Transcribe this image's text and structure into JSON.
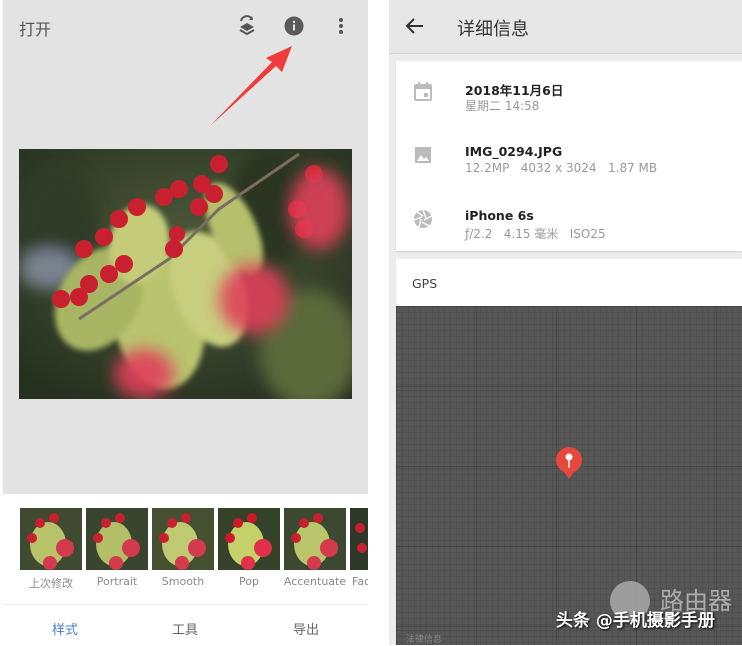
{
  "left_panel": {
    "title": "打开",
    "toolbar_icons": [
      "layers-swap-icon",
      "info-icon",
      "more-vert-icon"
    ],
    "annotation": "red-arrow-pointing-to-info",
    "styles": [
      {
        "label": "上次修改"
      },
      {
        "label": "Portrait"
      },
      {
        "label": "Smooth"
      },
      {
        "label": "Pop"
      },
      {
        "label": "Accentuate"
      },
      {
        "label": "Fac"
      }
    ],
    "tabs": [
      {
        "label": "样式",
        "active": true
      },
      {
        "label": "工具",
        "active": false
      },
      {
        "label": "导出",
        "active": false
      }
    ],
    "accent_color": "#4a7fd6"
  },
  "right_panel": {
    "title": "详细信息",
    "details": {
      "date": {
        "main": "2018年11月6日",
        "sub": "星期二 14:58"
      },
      "file": {
        "main": "IMG_0294.JPG",
        "sub": "12.2MP   4032 x 3024   1.87 MB"
      },
      "camera": {
        "main": "iPhone 6s",
        "sub": "ƒ/2.2   4.15 毫米   ISO25"
      }
    },
    "gps_label": "GPS",
    "map_legal": "法律信息",
    "pin_color": "#e8473b"
  },
  "watermark": {
    "brand": "路由器",
    "source": "头条 @手机摄影手册"
  }
}
